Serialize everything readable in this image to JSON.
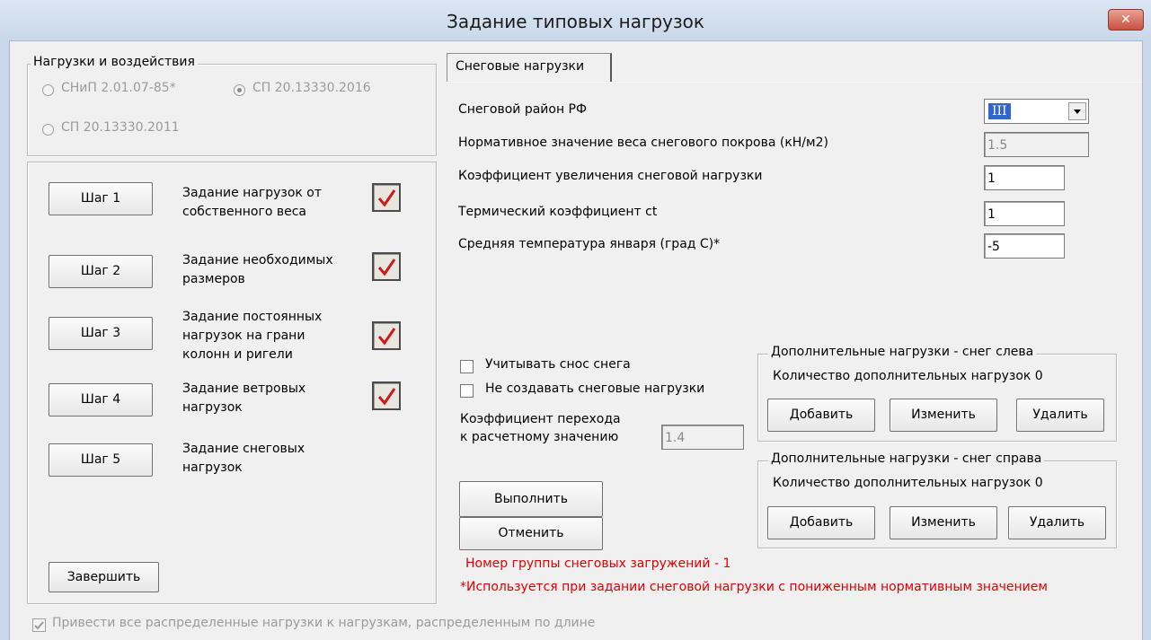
{
  "window": {
    "title": "Задание типовых нагрузок",
    "close_glyph": "✕"
  },
  "norms_group": {
    "legend": "Нагрузки и воздействия",
    "options": [
      {
        "label": "СНиП 2.01.07-85*",
        "selected": false
      },
      {
        "label": "СП 20.13330.2016",
        "selected": true
      },
      {
        "label": "СП 20.13330.2011",
        "selected": false
      }
    ]
  },
  "steps": [
    {
      "button": "Шаг 1",
      "text": [
        "Задание нагрузок от",
        "собственного веса"
      ],
      "done": true
    },
    {
      "button": "Шаг 2",
      "text": [
        "Задание необходимых",
        "размеров"
      ],
      "done": true
    },
    {
      "button": "Шаг 3",
      "text": [
        "Задание постоянных",
        "нагрузок на грани",
        "колонн и ригели"
      ],
      "done": true
    },
    {
      "button": "Шаг 4",
      "text": [
        "Задание ветровых",
        "нагрузок"
      ],
      "done": true
    },
    {
      "button": "Шаг 5",
      "text": [
        "Задание снеговых",
        "нагрузок"
      ],
      "done": false
    }
  ],
  "finish_button": "Завершить",
  "bottom_checkbox": {
    "label": "Привести все распределенные нагрузки к нагрузкам, распределенным по длине",
    "checked": true
  },
  "tab": {
    "label": "Снеговые нагрузки"
  },
  "snow": {
    "region_label": "Снеговой район РФ",
    "region_value": "III",
    "weight_label": "Нормативное значение веса снегового покрова (кН/м2)",
    "weight_value": "1.5",
    "increase_label": "Коэффициент увеличения снеговой нагрузки",
    "increase_value": "1",
    "thermal_label": "Термический коэффициент ct",
    "thermal_value": "1",
    "temp_label": "Средняя температура января (град С)*",
    "temp_value": "-5",
    "drift_label": "Учитывать снос снега",
    "nocreate_label": "Не создавать снеговые нагрузки",
    "transition_label_1": "Коэффициент перехода",
    "transition_label_2": "к расчетному значению",
    "transition_value": "1.4"
  },
  "actions": {
    "run": "Выполнить",
    "cancel": "Отменить"
  },
  "extra_left": {
    "legend": "Дополнительные нагрузки - снег слева",
    "count": "Количество дополнительных нагрузок 0",
    "add": "Добавить",
    "edit": "Изменить",
    "delete": "Удалить"
  },
  "extra_right": {
    "legend": "Дополнительные нагрузки - снег справа",
    "count": "Количество дополнительных нагрузок 0",
    "add": "Добавить",
    "edit": "Изменить",
    "delete": "Удалить"
  },
  "notes": {
    "group_number": "Номер группы снеговых загружений - 1",
    "footnote": "*Используется при задании снеговой нагрузки с пониженным нормативным значением"
  },
  "colors": {
    "accent_red": "#e00000",
    "check_red": "#cc1a1a"
  }
}
